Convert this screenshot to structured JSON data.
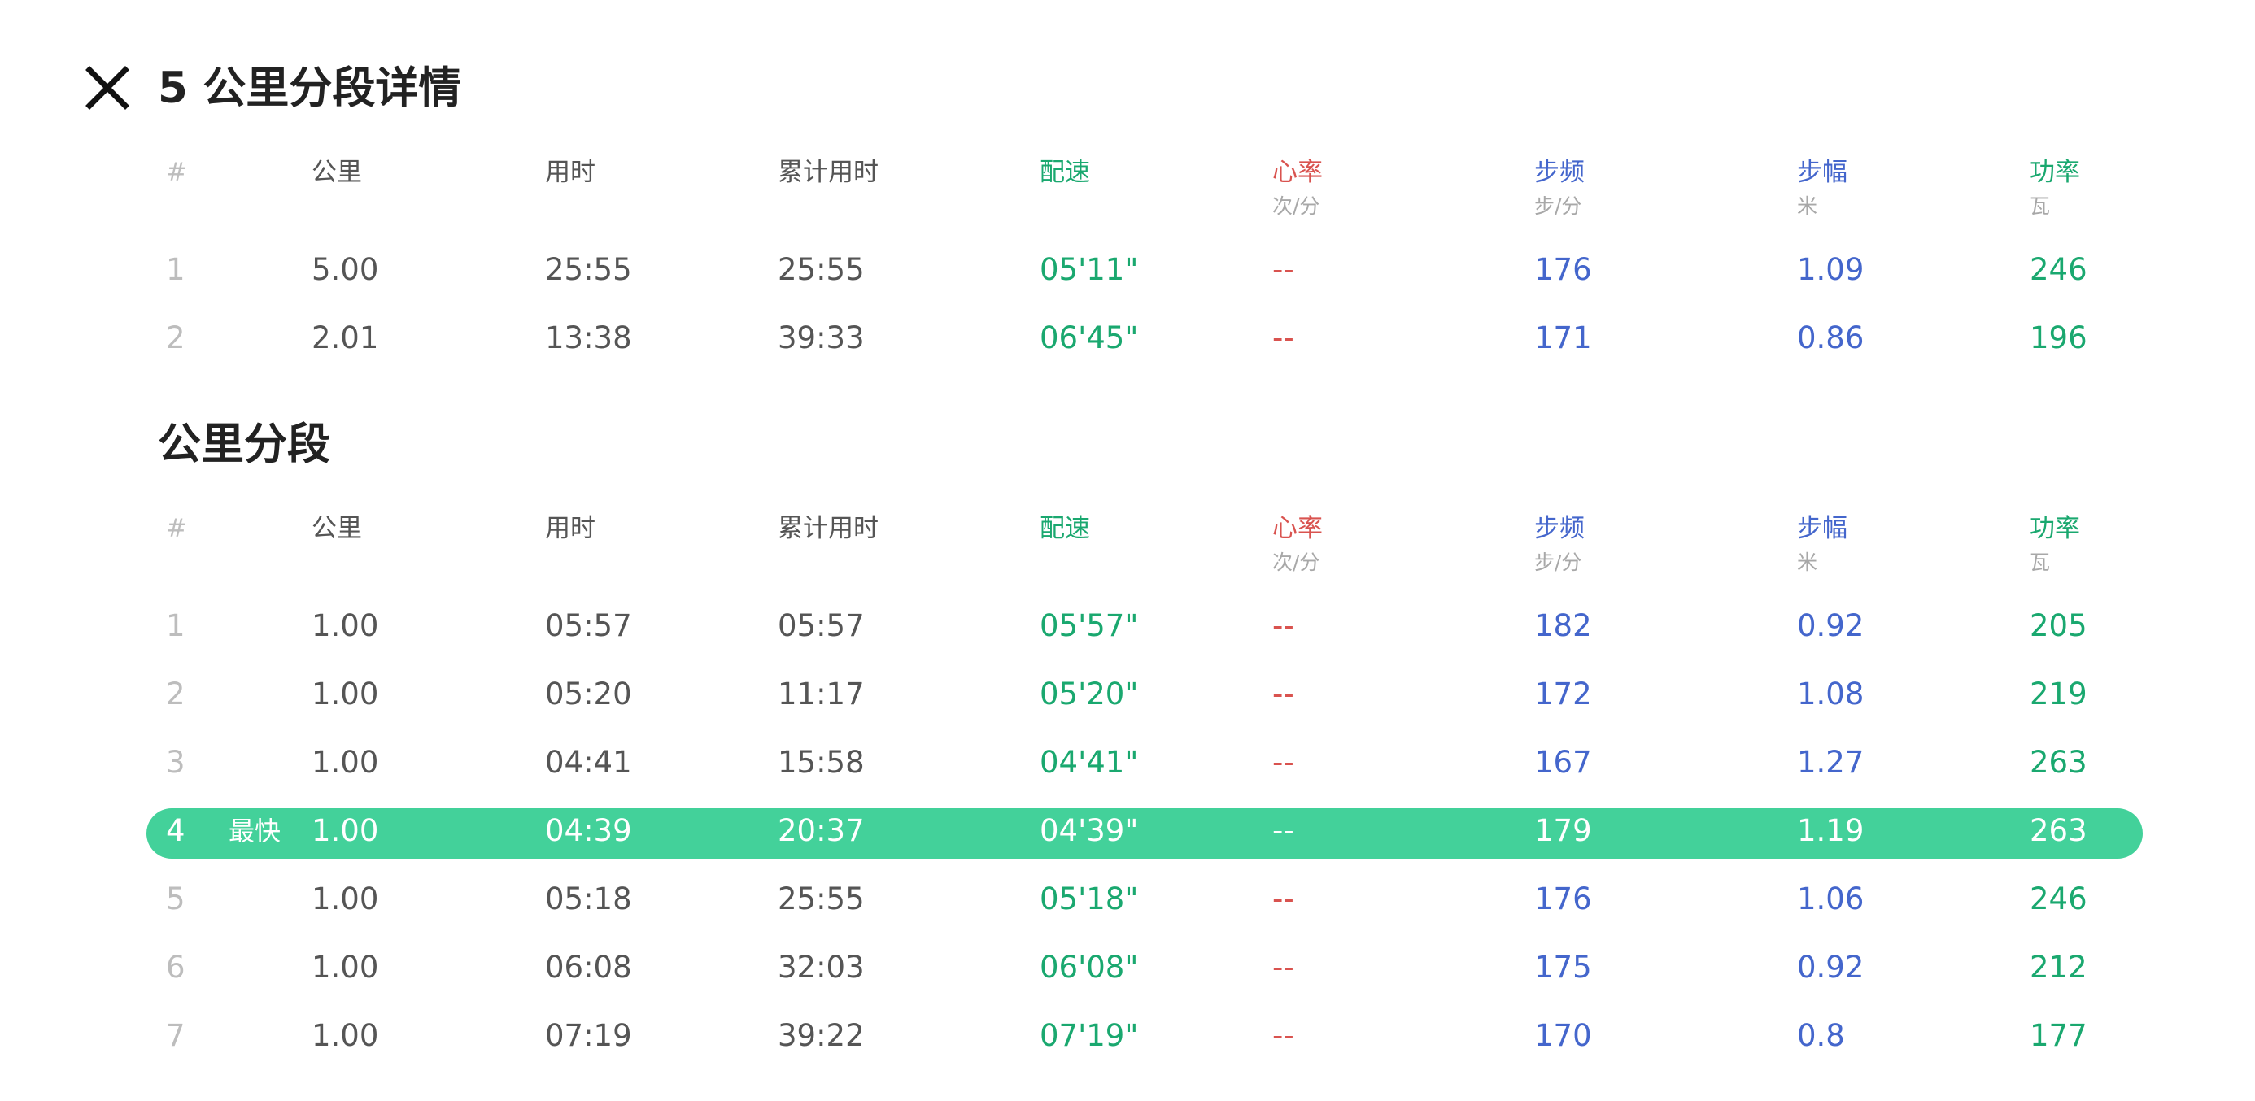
{
  "title": "5 公里分段详情",
  "section2_title": "公里分段",
  "headers": [
    {
      "label": "#",
      "unit": ""
    },
    {
      "label": "公里",
      "unit": ""
    },
    {
      "label": "用时",
      "unit": ""
    },
    {
      "label": "累计用时",
      "unit": ""
    },
    {
      "label": "配速",
      "unit": ""
    },
    {
      "label": "心率",
      "unit": "次/分"
    },
    {
      "label": "步频",
      "unit": "步/分"
    },
    {
      "label": "步幅",
      "unit": "米"
    },
    {
      "label": "功率",
      "unit": "瓦"
    }
  ],
  "splits_5km": [
    {
      "idx": "1",
      "km": "5.00",
      "time": "25:55",
      "cum": "25:55",
      "pace": "05'11\"",
      "hr": "--",
      "cadence": "176",
      "stride": "1.09",
      "power": "246"
    },
    {
      "idx": "2",
      "km": "2.01",
      "time": "13:38",
      "cum": "39:33",
      "pace": "06'45\"",
      "hr": "--",
      "cadence": "171",
      "stride": "0.86",
      "power": "196"
    }
  ],
  "splits_1km": [
    {
      "idx": "1",
      "km": "1.00",
      "time": "05:57",
      "cum": "05:57",
      "pace": "05'57\"",
      "hr": "--",
      "cadence": "182",
      "stride": "0.92",
      "power": "205"
    },
    {
      "idx": "2",
      "km": "1.00",
      "time": "05:20",
      "cum": "11:17",
      "pace": "05'20\"",
      "hr": "--",
      "cadence": "172",
      "stride": "1.08",
      "power": "219"
    },
    {
      "idx": "3",
      "km": "1.00",
      "time": "04:41",
      "cum": "15:58",
      "pace": "04'41\"",
      "hr": "--",
      "cadence": "167",
      "stride": "1.27",
      "power": "263"
    },
    {
      "idx": "4",
      "badge": "最快",
      "km": "1.00",
      "time": "04:39",
      "cum": "20:37",
      "pace": "04'39\"",
      "hr": "--",
      "cadence": "179",
      "stride": "1.19",
      "power": "263"
    },
    {
      "idx": "5",
      "km": "1.00",
      "time": "05:18",
      "cum": "25:55",
      "pace": "05'18\"",
      "hr": "--",
      "cadence": "176",
      "stride": "1.06",
      "power": "246"
    },
    {
      "idx": "6",
      "km": "1.00",
      "time": "06:08",
      "cum": "32:03",
      "pace": "06'08\"",
      "hr": "--",
      "cadence": "175",
      "stride": "0.92",
      "power": "212"
    },
    {
      "idx": "7",
      "km": "1.00",
      "time": "07:19",
      "cum": "39:22",
      "pace": "07'19\"",
      "hr": "--",
      "cadence": "170",
      "stride": "0.8",
      "power": "177"
    }
  ],
  "colors": {
    "highlight": "#43d19a",
    "pace": "#1aa86f",
    "heart_rate": "#d9534f",
    "cadence": "#4466cc",
    "stride": "#4466cc",
    "power": "#1aa86f"
  }
}
